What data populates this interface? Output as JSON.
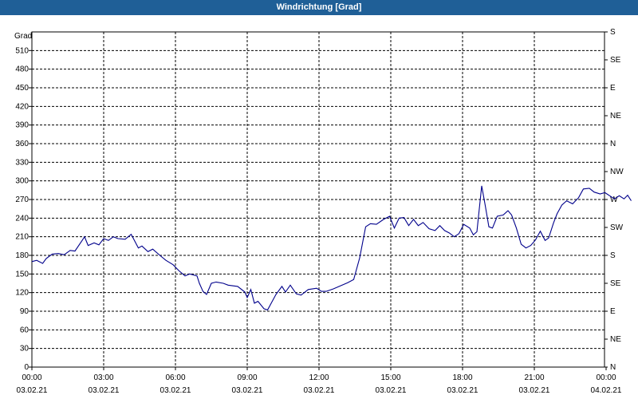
{
  "window": {
    "title": "Windrichtung [Grad]"
  },
  "chart_data": {
    "type": "line",
    "title": "Windrichtung [Grad]",
    "ylabel": "Grad",
    "ylim": [
      0,
      540
    ],
    "yticks": [
      0,
      30,
      60,
      90,
      120,
      150,
      180,
      210,
      240,
      270,
      300,
      330,
      360,
      390,
      420,
      450,
      480,
      510
    ],
    "right_axis": {
      "ticks": [
        0,
        45,
        90,
        135,
        180,
        225,
        270,
        315,
        360,
        405,
        450,
        495,
        540
      ],
      "labels": [
        "N",
        "NE",
        "E",
        "SE",
        "S",
        "SW",
        "W",
        "NW",
        "N",
        "NE",
        "E",
        "SE",
        "S"
      ]
    },
    "xlim": [
      0,
      24
    ],
    "xticks": [
      {
        "x": 0,
        "time": "00:00",
        "date": "03.02.21"
      },
      {
        "x": 3,
        "time": "03:00",
        "date": "03.02.21"
      },
      {
        "x": 6,
        "time": "06:00",
        "date": "03.02.21"
      },
      {
        "x": 9,
        "time": "09:00",
        "date": "03.02.21"
      },
      {
        "x": 12,
        "time": "12:00",
        "date": "03.02.21"
      },
      {
        "x": 15,
        "time": "15:00",
        "date": "03.02.21"
      },
      {
        "x": 18,
        "time": "18:00",
        "date": "03.02.21"
      },
      {
        "x": 21,
        "time": "21:00",
        "date": "03.02.21"
      },
      {
        "x": 24,
        "time": "00:00",
        "date": "04.02.21"
      }
    ],
    "grid": true,
    "series_color": "#00008b",
    "series": [
      {
        "name": "",
        "points": [
          [
            0.0,
            170
          ],
          [
            0.2,
            172
          ],
          [
            0.45,
            167
          ],
          [
            0.6,
            175
          ],
          [
            0.85,
            182
          ],
          [
            1.1,
            183
          ],
          [
            1.35,
            181
          ],
          [
            1.6,
            188
          ],
          [
            1.8,
            187
          ],
          [
            2.1,
            204
          ],
          [
            2.2,
            210
          ],
          [
            2.35,
            196
          ],
          [
            2.6,
            200
          ],
          [
            2.8,
            197
          ],
          [
            3.0,
            207
          ],
          [
            3.2,
            204
          ],
          [
            3.4,
            210
          ],
          [
            3.6,
            207
          ],
          [
            3.9,
            206
          ],
          [
            4.15,
            214
          ],
          [
            4.45,
            192
          ],
          [
            4.6,
            195
          ],
          [
            4.85,
            186
          ],
          [
            5.05,
            190
          ],
          [
            5.35,
            180
          ],
          [
            5.6,
            172
          ],
          [
            5.9,
            165
          ],
          [
            6.15,
            155
          ],
          [
            6.4,
            147
          ],
          [
            6.6,
            150
          ],
          [
            6.9,
            147
          ],
          [
            7.0,
            135
          ],
          [
            7.15,
            122
          ],
          [
            7.3,
            117
          ],
          [
            7.5,
            135
          ],
          [
            7.7,
            137
          ],
          [
            8.0,
            135
          ],
          [
            8.2,
            132
          ],
          [
            8.6,
            130
          ],
          [
            8.9,
            121
          ],
          [
            9.0,
            112
          ],
          [
            9.15,
            125
          ],
          [
            9.3,
            103
          ],
          [
            9.45,
            106
          ],
          [
            9.7,
            94
          ],
          [
            9.85,
            92
          ],
          [
            10.2,
            117
          ],
          [
            10.45,
            130
          ],
          [
            10.6,
            121
          ],
          [
            10.8,
            132
          ],
          [
            11.05,
            118
          ],
          [
            11.25,
            116
          ],
          [
            11.55,
            125
          ],
          [
            11.9,
            127
          ],
          [
            12.1,
            122
          ],
          [
            12.3,
            122
          ],
          [
            12.6,
            126
          ],
          [
            12.9,
            131
          ],
          [
            13.2,
            136
          ],
          [
            13.45,
            141
          ],
          [
            13.7,
            176
          ],
          [
            13.95,
            226
          ],
          [
            14.15,
            231
          ],
          [
            14.4,
            230
          ],
          [
            14.7,
            238
          ],
          [
            14.95,
            243
          ],
          [
            15.15,
            224
          ],
          [
            15.35,
            240
          ],
          [
            15.55,
            241
          ],
          [
            15.75,
            228
          ],
          [
            15.95,
            238
          ],
          [
            16.15,
            228
          ],
          [
            16.35,
            233
          ],
          [
            16.6,
            223
          ],
          [
            16.85,
            220
          ],
          [
            17.05,
            228
          ],
          [
            17.25,
            220
          ],
          [
            17.45,
            216
          ],
          [
            17.65,
            210
          ],
          [
            17.85,
            215
          ],
          [
            18.05,
            230
          ],
          [
            18.3,
            224
          ],
          [
            18.45,
            213
          ],
          [
            18.6,
            218
          ],
          [
            18.8,
            292
          ],
          [
            18.95,
            260
          ],
          [
            19.1,
            226
          ],
          [
            19.25,
            224
          ],
          [
            19.45,
            243
          ],
          [
            19.7,
            245
          ],
          [
            19.9,
            252
          ],
          [
            20.05,
            245
          ],
          [
            20.25,
            224
          ],
          [
            20.45,
            198
          ],
          [
            20.65,
            192
          ],
          [
            20.85,
            196
          ],
          [
            21.05,
            205
          ],
          [
            21.25,
            219
          ],
          [
            21.45,
            204
          ],
          [
            21.6,
            208
          ],
          [
            21.8,
            232
          ],
          [
            21.95,
            247
          ],
          [
            22.15,
            261
          ],
          [
            22.35,
            268
          ],
          [
            22.6,
            263
          ],
          [
            22.85,
            273
          ],
          [
            23.05,
            287
          ],
          [
            23.3,
            288
          ],
          [
            23.5,
            282
          ],
          [
            23.75,
            279
          ],
          [
            23.95,
            281
          ],
          [
            24.15,
            276
          ],
          [
            24.35,
            271
          ],
          [
            24.55,
            276
          ],
          [
            24.75,
            271
          ],
          [
            24.9,
            277
          ],
          [
            25.05,
            268
          ]
        ]
      }
    ]
  }
}
